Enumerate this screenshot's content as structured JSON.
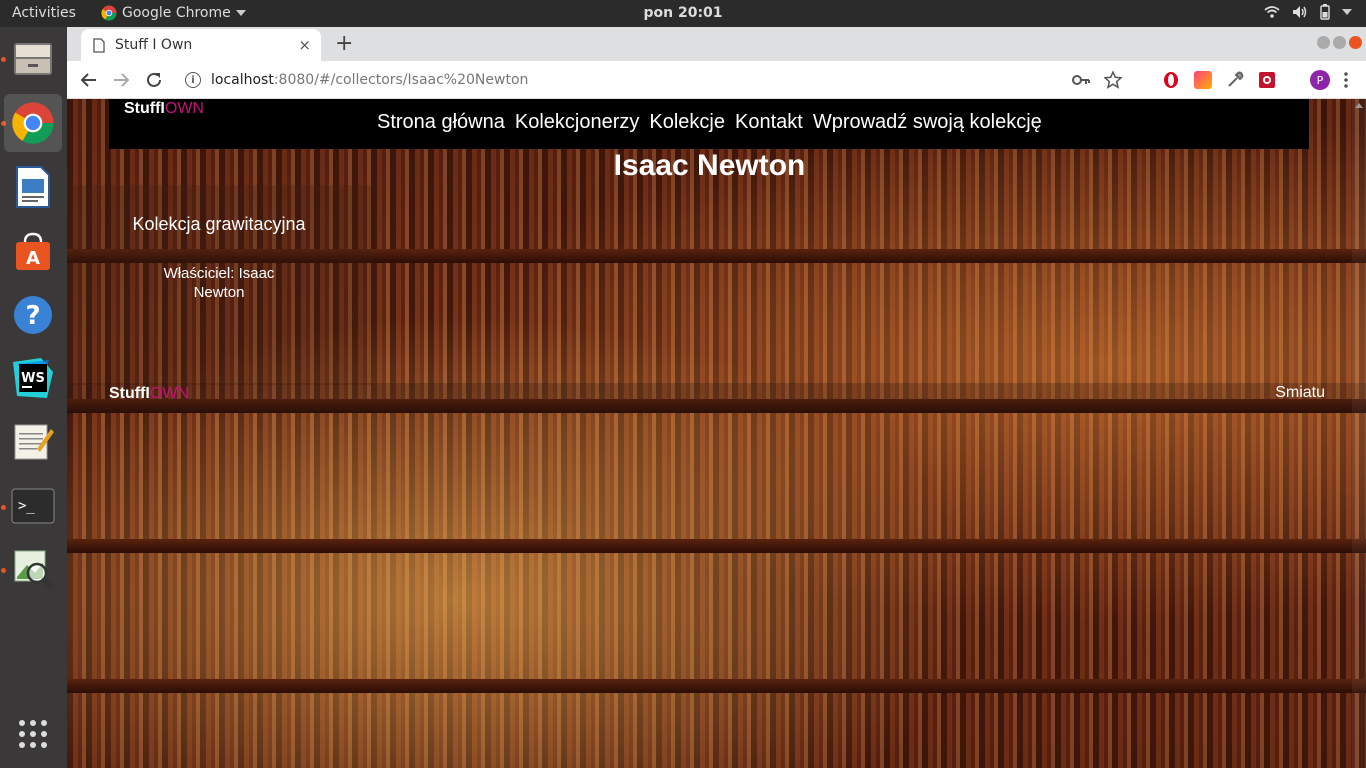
{
  "topbar": {
    "activities": "Activities",
    "app_name": "Google Chrome",
    "clock": "pon 20:01"
  },
  "dock": {
    "items": [
      "files-icon",
      "chrome-icon",
      "writer-icon",
      "software-center-icon",
      "help-icon",
      "webstorm-icon",
      "text-editor-icon",
      "terminal-icon",
      "image-viewer-icon"
    ]
  },
  "browser": {
    "tab_title": "Stuff I Own",
    "tab_close": "×",
    "new_tab": "+",
    "url_host": "localhost",
    "url_rest": ":8080/#/collectors/Isaac%20Newton",
    "avatar_letter": "P"
  },
  "site": {
    "logo_stuff": "StuffI",
    "logo_own": "OWN",
    "nav": [
      "Strona główna",
      "Kolekcjonerzy",
      "Kolekcje",
      "Kontakt",
      "Wprowadź swoją kolekcję"
    ],
    "page_title": "Isaac Newton",
    "collection": {
      "name": "Kolekcja grawitacyjna",
      "owner": "Właściciel: Isaac Newton"
    },
    "footer": {
      "logo_stuff": "StuffI",
      "logo_own": "OWN",
      "right_text": "Smiatu"
    }
  },
  "colors": {
    "accent_own": "#c4127a",
    "header_bg": "#000000",
    "ubuntu_orange": "#e95420"
  }
}
